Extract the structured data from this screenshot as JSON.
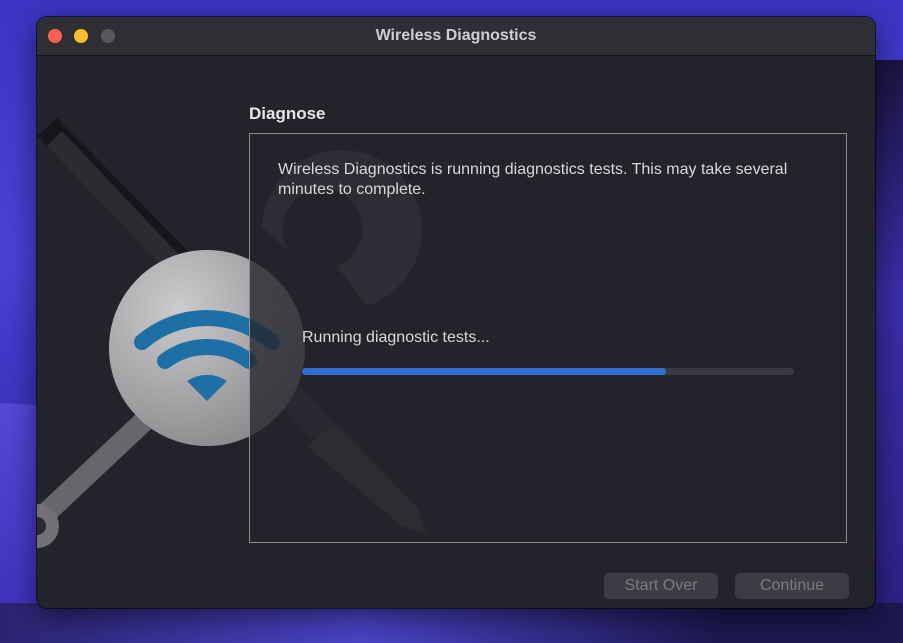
{
  "window": {
    "title": "Wireless Diagnostics"
  },
  "page": {
    "heading": "Diagnose",
    "description": "Wireless Diagnostics is running diagnostics tests. This may take several minutes to complete.",
    "status": "Running diagnostic tests...",
    "progress": 0.74
  },
  "buttons": {
    "start_over": "Start Over",
    "continue": "Continue"
  },
  "colors": {
    "accent": "#2f6fd3",
    "window_bg": "#23232b",
    "close": "#fe5f57",
    "minimize": "#febc2e",
    "zoom_disabled": "#58585c"
  },
  "icons": {
    "art": "wifi-tools-icon"
  }
}
